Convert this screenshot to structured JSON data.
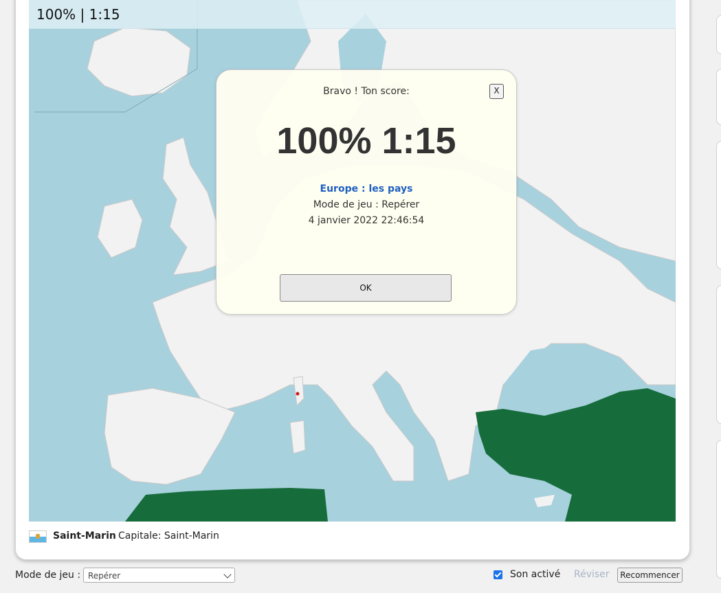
{
  "scorebar": {
    "text": "100% | 1:15"
  },
  "modal": {
    "heading": "Bravo ! Ton score:",
    "close_label": "X",
    "big_score": "100% 1:15",
    "quiz_title": "Europe : les pays",
    "mode_line": "Mode de jeu : Repérer",
    "date_line": "4 janvier 2022  22:46:54",
    "ok_label": "OK"
  },
  "country": {
    "flag": "san-marino-flag",
    "name": "Saint-Marin",
    "capital": "Capitale: Saint-Marin"
  },
  "controls": {
    "mode_label": "Mode de jeu :",
    "mode_value": "Repérer",
    "sound_label": "Son activé",
    "sound_checked": true,
    "review_label": "Réviser",
    "restart_label": "Recommencer"
  },
  "colors": {
    "sea": "#a8d1de",
    "land": "#f2f2f2",
    "highlight_land": "#166d3b",
    "modal_bg": "#ffffef",
    "accent": "#1f5fbf"
  }
}
